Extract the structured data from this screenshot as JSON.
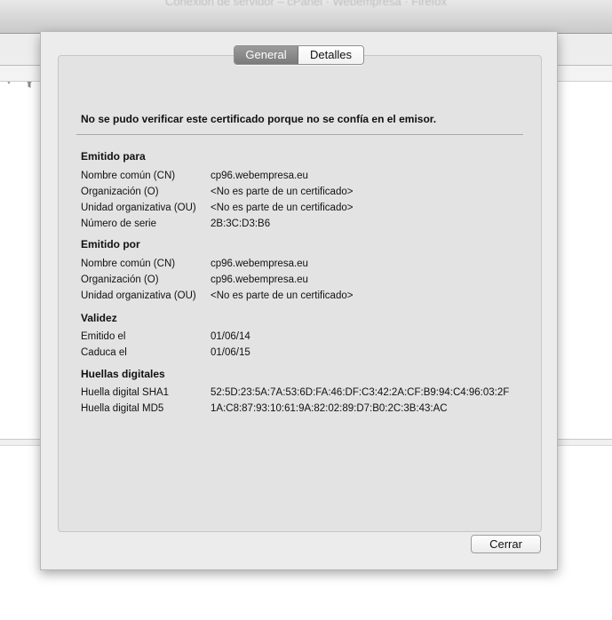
{
  "background_window": {
    "title": "Conexión de servidor – cPanel · Webempresa · Firefox"
  },
  "tabs": [
    {
      "label": "General",
      "active": true
    },
    {
      "label": "Detalles",
      "active": false
    }
  ],
  "warning": "No se pudo verificar este certificado porque no se confía en el emisor.",
  "issued_to": {
    "title": "Emitido para",
    "rows": [
      {
        "label": "Nombre común (CN)",
        "value": "cp96.webempresa.eu"
      },
      {
        "label": "Organización (O)",
        "value": "<No es parte de un certificado>"
      },
      {
        "label": "Unidad organizativa (OU)",
        "value": "<No es parte de un certificado>"
      },
      {
        "label": "Número de serie",
        "value": "2B:3C:D3:B6"
      }
    ]
  },
  "issued_by": {
    "title": "Emitido por",
    "rows": [
      {
        "label": "Nombre común (CN)",
        "value": "cp96.webempresa.eu"
      },
      {
        "label": "Organización (O)",
        "value": "cp96.webempresa.eu"
      },
      {
        "label": "Unidad organizativa (OU)",
        "value": "<No es parte de un certificado>"
      }
    ]
  },
  "validity": {
    "title": "Validez",
    "rows": [
      {
        "label": "Emitido el",
        "value": "01/06/14"
      },
      {
        "label": "Caduca el",
        "value": "01/06/15"
      }
    ]
  },
  "fingerprints": {
    "title": "Huellas digitales",
    "rows": [
      {
        "label": "Huella digital SHA1",
        "value": "52:5D:23:5A:7A:53:6D:FA:46:DF:C3:42:2A:CF:B9:94:C4:96:03:2F"
      },
      {
        "label": "Huella digital MD5",
        "value": "1A:C8:87:93:10:61:9A:82:02:89:D7:B0:2C:3B:43:AC"
      }
    ]
  },
  "close_button": "Cerrar"
}
